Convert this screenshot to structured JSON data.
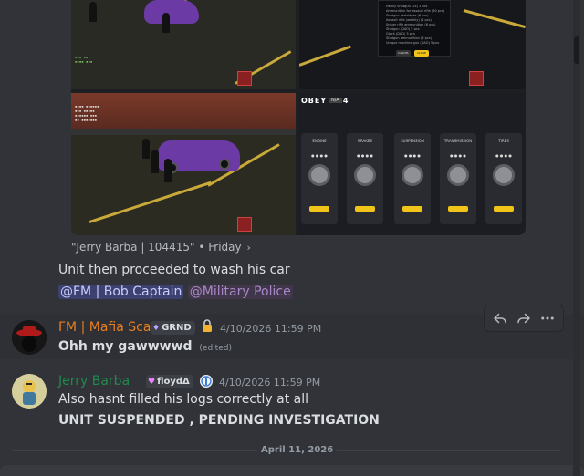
{
  "forward": {
    "source": "\"Jerry Barba | 104415\"",
    "separator": "•",
    "when": "Friday",
    "chevron": "›"
  },
  "forwarded_message": {
    "text": "Unit then proceeded to wash his car",
    "mention_user": "@FM | Bob Captain",
    "mention_role": "@Military Police"
  },
  "embed": {
    "tune_shop_title": "OBEY RS4",
    "tune_badge": "N/A",
    "tune_cards": [
      "ENGINE",
      "BRAKES",
      "SUSPENSION",
      "TRANSMISSION",
      "TIRES"
    ],
    "tune_card_dots": "● ● ● ●",
    "dialog_lines": [
      "Heavy Shotgun (2x) 1 pcs",
      "Ammunition for assault rifle (30 pcs)",
      "Shotgun cartridges (6 pcs)",
      "Assault rifle (weekly) (1 pcs)",
      "Sniper rifle ammunition (6 pcs)",
      "Shotgun (DAO) 5 pcs",
      "Glock (DAO) 5 pcs",
      "Shotgun ammunition (6 pcs)",
      "Unique machine gun (DAO) 5 pcs"
    ],
    "dialog_cancel": "CANCEL",
    "dialog_confirm": "CLOSE"
  },
  "toolbar": {
    "reply_icon": "reply-arrow-icon",
    "forward_icon": "forward-arrow-icon",
    "more_icon": "more-dots-icon"
  },
  "messages": [
    {
      "username": "FM | Mafia Scar",
      "username_color": "#e67e22",
      "tag": "GRND",
      "timestamp": "4/10/2026 11:59 PM",
      "text": "Ohh my gawwwwd",
      "edited": "(edited)"
    },
    {
      "username": "Jerry Barba",
      "username_color": "#1f8b4c",
      "tag": "floydΔ",
      "timestamp": "4/10/2026 11:59 PM",
      "line1": "Also hasnt filled his logs correctly at all",
      "line2": "UNIT SUSPENDED , PENDING INVESTIGATION"
    }
  ],
  "date_divider": "April 11, 2026",
  "colors": {
    "background": "#313338",
    "hover": "#2e3035",
    "text": "#dbdee1",
    "muted": "#949ba4",
    "mention_bg": "#5865f2",
    "role_purple": "#a987c7"
  }
}
